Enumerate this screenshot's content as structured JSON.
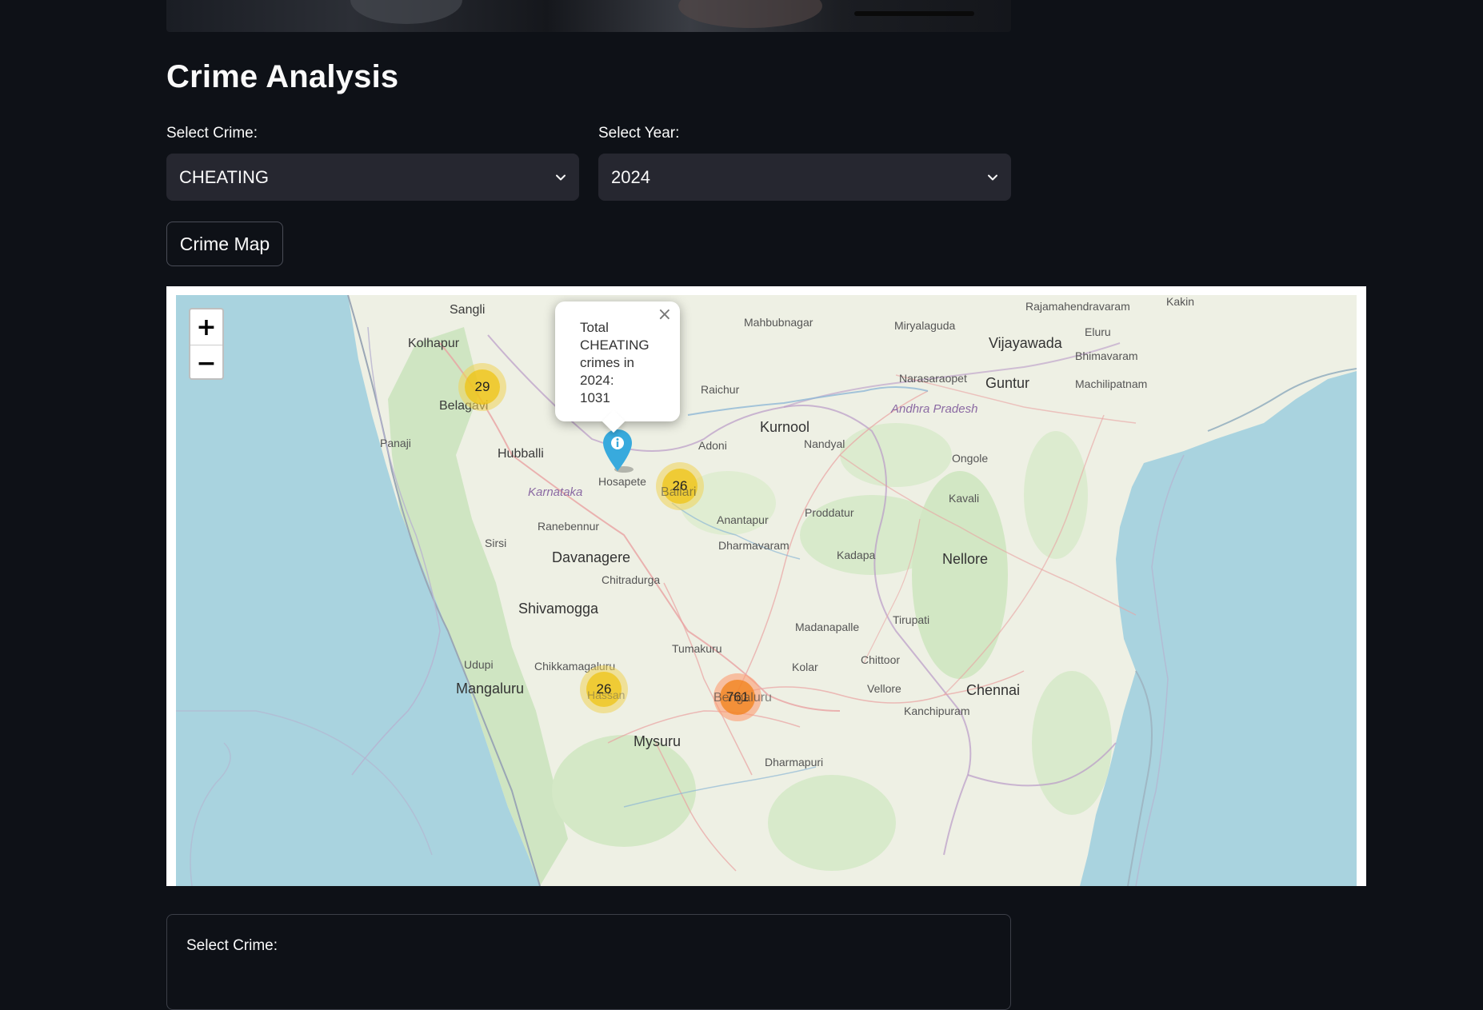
{
  "page": {
    "title": "Crime Analysis"
  },
  "filters": {
    "crime_label": "Select Crime:",
    "crime_value": "CHEATING",
    "year_label": "Select Year:",
    "year_value": "2024"
  },
  "actions": {
    "crime_map_label": "Crime Map"
  },
  "map": {
    "zoom_in": "+",
    "zoom_out": "−",
    "popup": {
      "lines": [
        "Total",
        "CHEATING",
        "crimes in",
        "2024:",
        "1031"
      ],
      "close": "×"
    },
    "clusters": [
      {
        "label": "29",
        "color": "yellow"
      },
      {
        "label": "26",
        "color": "yellow"
      },
      {
        "label": "26",
        "color": "yellow"
      },
      {
        "label": "761",
        "color": "orange"
      }
    ],
    "places": {
      "sangli": "Sangli",
      "kolhapur": "Kolhapur",
      "belagavi": "Belagavi",
      "panaji": "Panaji",
      "hubballi": "Hubballi",
      "karnataka": "Karnataka",
      "hosapete": "Hosapete",
      "ballari": "Ballari",
      "ranebennur": "Ranebennur",
      "sirsi": "Sirsi",
      "davanagere": "Davanagere",
      "chitradurga": "Chitradurga",
      "shivamogga": "Shivamogga",
      "udupi": "Udupi",
      "chikkamagaluru": "Chikkamagaluru",
      "mangaluru": "Mangaluru",
      "hassan": "Hassan",
      "tumakuru": "Tumakuru",
      "bengaluru": "Bengaluru",
      "mysuru": "Mysuru",
      "mahbubnagar": "Mahbubnagar",
      "raichur": "Raichur",
      "kurnool": "Kurnool",
      "adoni": "Adoni",
      "nandyal": "Nandyal",
      "anantapur": "Anantapur",
      "dharmavaram": "Dharmavaram",
      "proddatur": "Proddatur",
      "kadapa": "Kadapa",
      "madanapalle": "Madanapalle",
      "kolar": "Kolar",
      "chittoor": "Chittoor",
      "vellore": "Vellore",
      "tirupati": "Tirupati",
      "chennai": "Chennai",
      "kanchipuram": "Kanchipuram",
      "dharmapuri": "Dharmapuri",
      "nellore": "Nellore",
      "kavali": "Kavali",
      "ongole": "Ongole",
      "guntur": "Guntur",
      "vijayawada": "Vijayawada",
      "miryalaguda": "Miryalaguda",
      "narasaraopet": "Narasaraopet",
      "andhra": "Andhra Pradesh",
      "eluru": "Eluru",
      "bhimavaram": "Bhimavaram",
      "machilipatnam": "Machilipatnam",
      "rajamahendravaram": "Rajamahendravaram",
      "kakinada": "Kakin"
    }
  },
  "lower_panel": {
    "crime_label": "Select Crime:"
  }
}
